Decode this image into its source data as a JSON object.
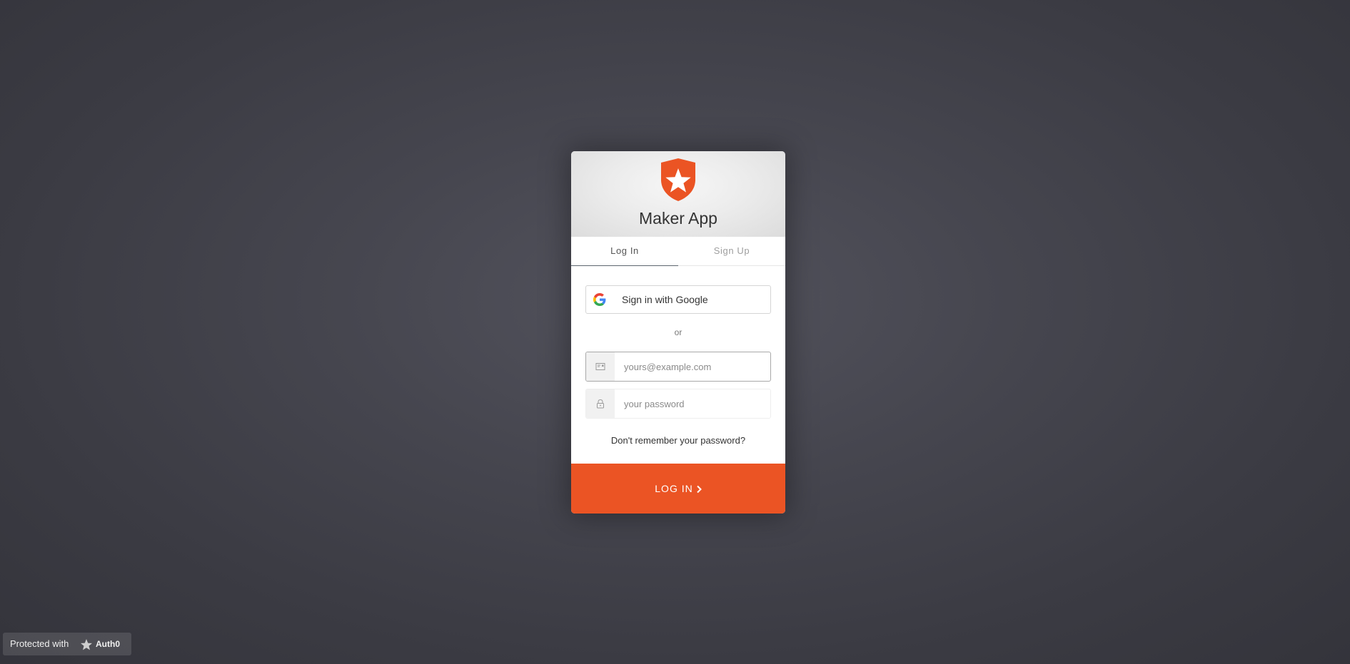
{
  "app": {
    "title": "Maker App",
    "logo_icon": "auth0-shield-star-icon",
    "brand_color": "#eb5424"
  },
  "tabs": [
    {
      "label": "Log In",
      "active": true
    },
    {
      "label": "Sign Up",
      "active": false
    }
  ],
  "social": {
    "google_label": "Sign in with Google",
    "google_icon": "google-g-icon"
  },
  "separator_text": "or",
  "email": {
    "placeholder": "yours@example.com",
    "value": "",
    "icon": "envelope-icon"
  },
  "password": {
    "placeholder": "your password",
    "value": "",
    "icon": "lock-icon"
  },
  "forgot_label": "Don't remember your password?",
  "submit": {
    "label": "LOG IN",
    "icon": "chevron-right-icon"
  },
  "badge": {
    "text": "Protected with",
    "brand": "Auth0"
  }
}
